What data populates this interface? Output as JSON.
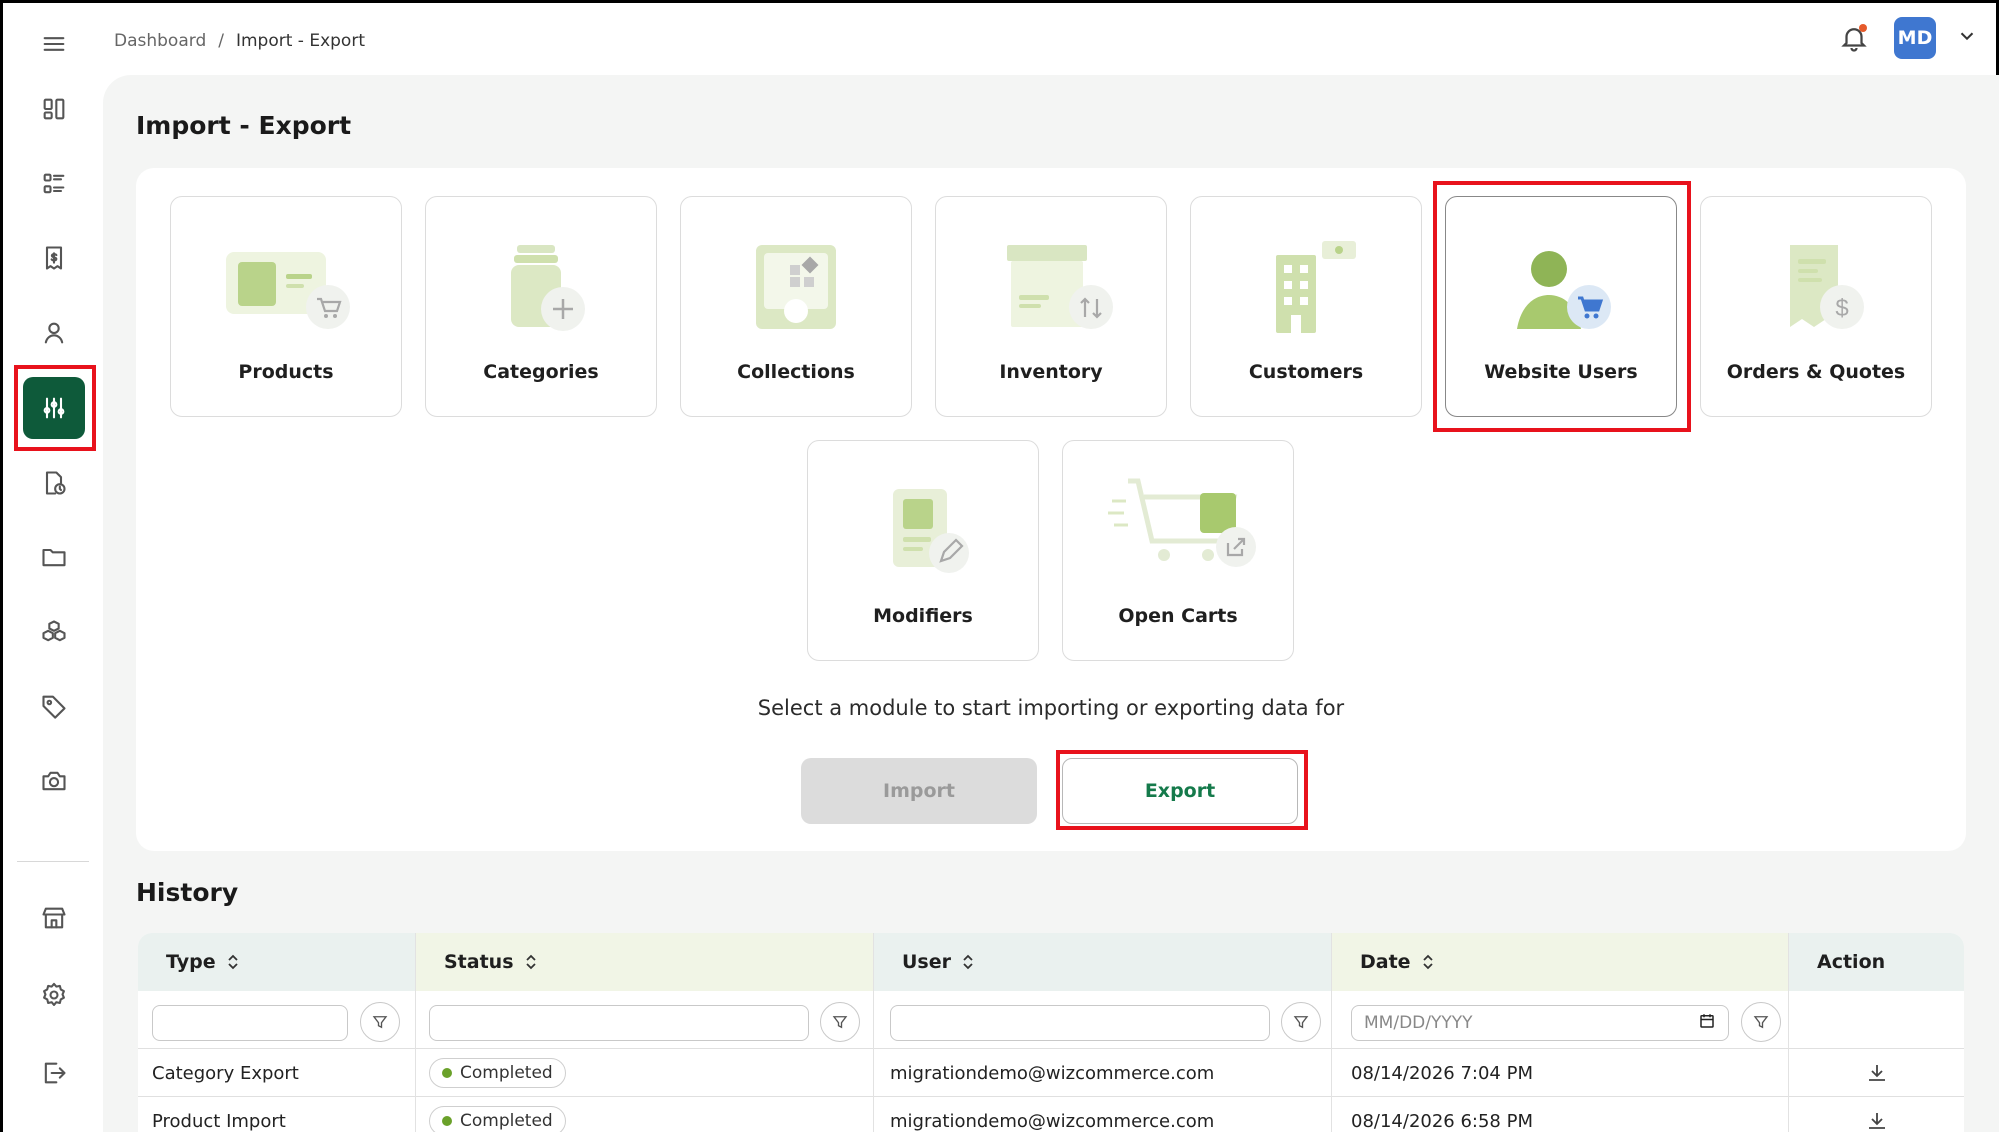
{
  "breadcrumb": {
    "root": "Dashboard",
    "separator": "/",
    "current": "Import - Export"
  },
  "user": {
    "initials": "MD"
  },
  "page": {
    "title": "Import - Export"
  },
  "modules": [
    {
      "label": "Products",
      "icon": "products-illustration"
    },
    {
      "label": "Categories",
      "icon": "categories-illustration"
    },
    {
      "label": "Collections",
      "icon": "collections-illustration"
    },
    {
      "label": "Inventory",
      "icon": "inventory-illustration"
    },
    {
      "label": "Customers",
      "icon": "customers-illustration"
    },
    {
      "label": "Website Users",
      "icon": "website-users-illustration",
      "selected": true
    },
    {
      "label": "Orders & Quotes",
      "icon": "orders-quotes-illustration"
    },
    {
      "label": "Modifiers",
      "icon": "modifiers-illustration"
    },
    {
      "label": "Open Carts",
      "icon": "open-carts-illustration"
    }
  ],
  "hint": "Select a module to start importing or exporting data for",
  "actions": {
    "import_label": "Import",
    "export_label": "Export"
  },
  "history": {
    "title": "History",
    "columns": [
      "Type",
      "Status",
      "User",
      "Date",
      "Action"
    ],
    "date_placeholder": "MM/DD/YYYY",
    "rows": [
      {
        "type": "Category Export",
        "status": "Completed",
        "user": "migrationdemo@wizcommerce.com",
        "date": "08/14/2026 7:04 PM"
      },
      {
        "type": "Product Import",
        "status": "Completed",
        "user": "migrationdemo@wizcommerce.com",
        "date": "08/14/2026 6:58 PM"
      }
    ]
  },
  "colors": {
    "brand": "#0e5a3a",
    "accent": "#157a4b",
    "highlight": "#e8121c",
    "status_completed": "#6aa12a"
  }
}
